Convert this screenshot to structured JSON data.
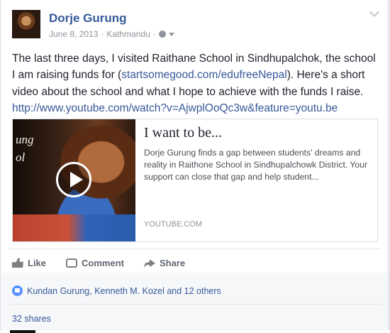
{
  "post": {
    "author": "Dorje Gurung",
    "date": "June 8, 2013",
    "separator": "·",
    "location": "Kathmandu",
    "text_part1": "The last three days, I visited Raithane School in Sindhupalchok, the school I am raising funds for (",
    "text_link1": "startsomegood.com/edufreeNepal",
    "text_part2": "). Here's a short video about the school and what I hope to achieve with the funds I raise.",
    "text_link2": "http://www.youtube.com/watch?v=AjwplOoQc3w&feature=youtu.be"
  },
  "card": {
    "thumb_text": "ung ol",
    "title": "I want to be...",
    "description": "Dorje Gurung finds a gap between students' dreams and reality in Raithone School in Sindhupalchowk District. Your support can close that gap and help student...",
    "domain": "YOUTUBE.COM"
  },
  "actions": {
    "like": "Like",
    "comment": "Comment",
    "share": "Share"
  },
  "reactions": {
    "likes_text": "Kundan Gurung, Kenneth M. Kozel and 12 others",
    "shares_text": "32 shares"
  },
  "colors": {
    "link": "#365899",
    "meta": "#90949c",
    "like_badge": "#5890ff"
  },
  "icons": {
    "privacy": "globe-icon",
    "menu": "chevron-down-icon",
    "play": "play-icon"
  }
}
